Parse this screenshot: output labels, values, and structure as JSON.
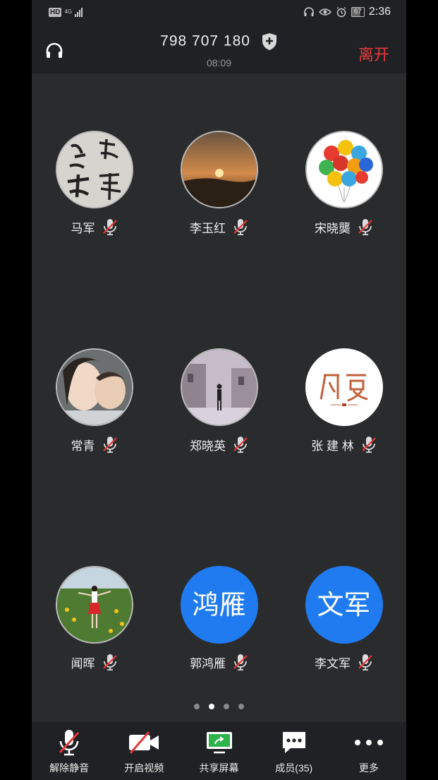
{
  "status_bar": {
    "hd": "HD",
    "network": "4G",
    "battery": "67",
    "time": "2:36"
  },
  "header": {
    "meeting_id": "798 707 180",
    "duration": "08:09",
    "leave_label": "离开"
  },
  "participants": [
    {
      "name": "马军",
      "avatar_text": "",
      "avatar_kind": "calligraphy"
    },
    {
      "name": "李玉红",
      "avatar_text": "",
      "avatar_kind": "sunset"
    },
    {
      "name": "宋晓龑",
      "avatar_text": "",
      "avatar_kind": "balloons"
    },
    {
      "name": "常青",
      "avatar_text": "",
      "avatar_kind": "portrait"
    },
    {
      "name": "郑晓英",
      "avatar_text": "",
      "avatar_kind": "street"
    },
    {
      "name": "张 建 林",
      "avatar_text": "",
      "avatar_kind": "logo"
    },
    {
      "name": "闻晖",
      "avatar_text": "",
      "avatar_kind": "field"
    },
    {
      "name": "郭鸿雁",
      "avatar_text": "鸿雁",
      "avatar_kind": "text"
    },
    {
      "name": "李文军",
      "avatar_text": "文军",
      "avatar_kind": "text"
    }
  ],
  "pagination": {
    "pages": 4,
    "active": 1
  },
  "toolbar": {
    "unmute": "解除静音",
    "video": "开启视频",
    "share": "共享屏幕",
    "members": "成员(35)",
    "more": "更多"
  },
  "colors": {
    "accent_blue": "#1f7bef",
    "leave_red": "#e5383b",
    "share_green": "#2eb34a",
    "muted_red": "#e5383b"
  }
}
